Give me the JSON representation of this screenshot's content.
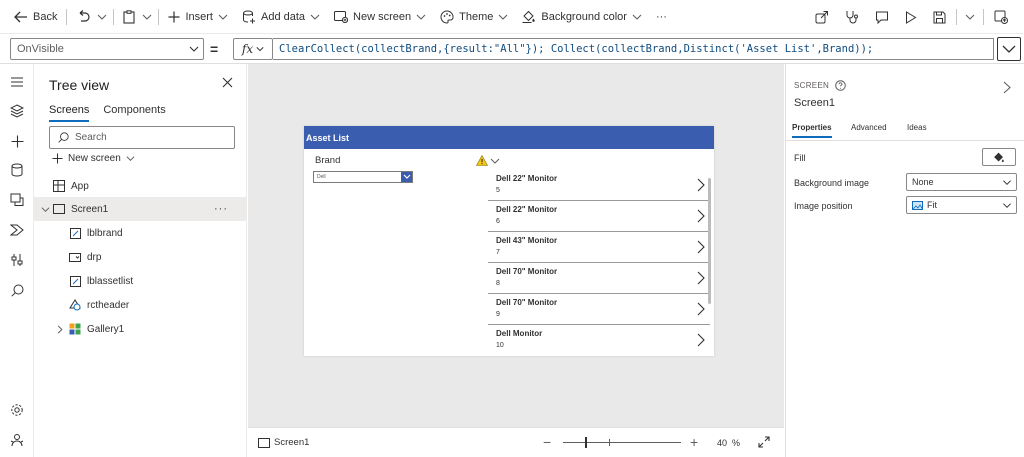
{
  "toolbar": {
    "back": "Back",
    "insert": "Insert",
    "add_data": "Add data",
    "new_screen": "New screen",
    "theme": "Theme",
    "background_color": "Background color",
    "more": "···"
  },
  "formula_bar": {
    "property": "OnVisible",
    "equals": "=",
    "fx": "fx",
    "formula": "ClearCollect(collectBrand,{result:\"All\"}); Collect(collectBrand,Distinct('Asset List',Brand));"
  },
  "tree": {
    "title": "Tree view",
    "tabs": [
      "Screens",
      "Components"
    ],
    "search_placeholder": "Search",
    "new_screen": "New screen",
    "items": {
      "app": "App",
      "screen1": "Screen1",
      "lblbrand": "lblbrand",
      "drp": "drp",
      "lblassetlist": "lblassetlist",
      "rctheader": "rctheader",
      "gallery1": "Gallery1"
    },
    "ellipsis": "···"
  },
  "app_screen": {
    "header": "Asset List",
    "brand_label": "Brand",
    "dropdown_value": "Dell",
    "gallery": [
      {
        "title": "Dell 22\" Monitor",
        "sub": "5"
      },
      {
        "title": "Dell 22\" Monitor",
        "sub": "6"
      },
      {
        "title": "Dell 43\" Monitor",
        "sub": "7"
      },
      {
        "title": "Dell 70\" Monitor",
        "sub": "8"
      },
      {
        "title": "Dell 70\" Monitor",
        "sub": "9"
      },
      {
        "title": "Dell Monitor",
        "sub": "10"
      }
    ]
  },
  "status": {
    "screen": "Screen1",
    "zoom": "40",
    "zoom_unit": "%"
  },
  "properties": {
    "caption": "SCREEN",
    "name": "Screen1",
    "tabs": [
      "Properties",
      "Advanced",
      "Ideas"
    ],
    "fill_label": "Fill",
    "bg_image_label": "Background image",
    "bg_image_value": "None",
    "image_position_label": "Image position",
    "image_position_value": "Fit"
  },
  "colors": {
    "header_blue": "#3a5daf",
    "accent": "#0f6cbd",
    "warning": "#f2c811"
  }
}
